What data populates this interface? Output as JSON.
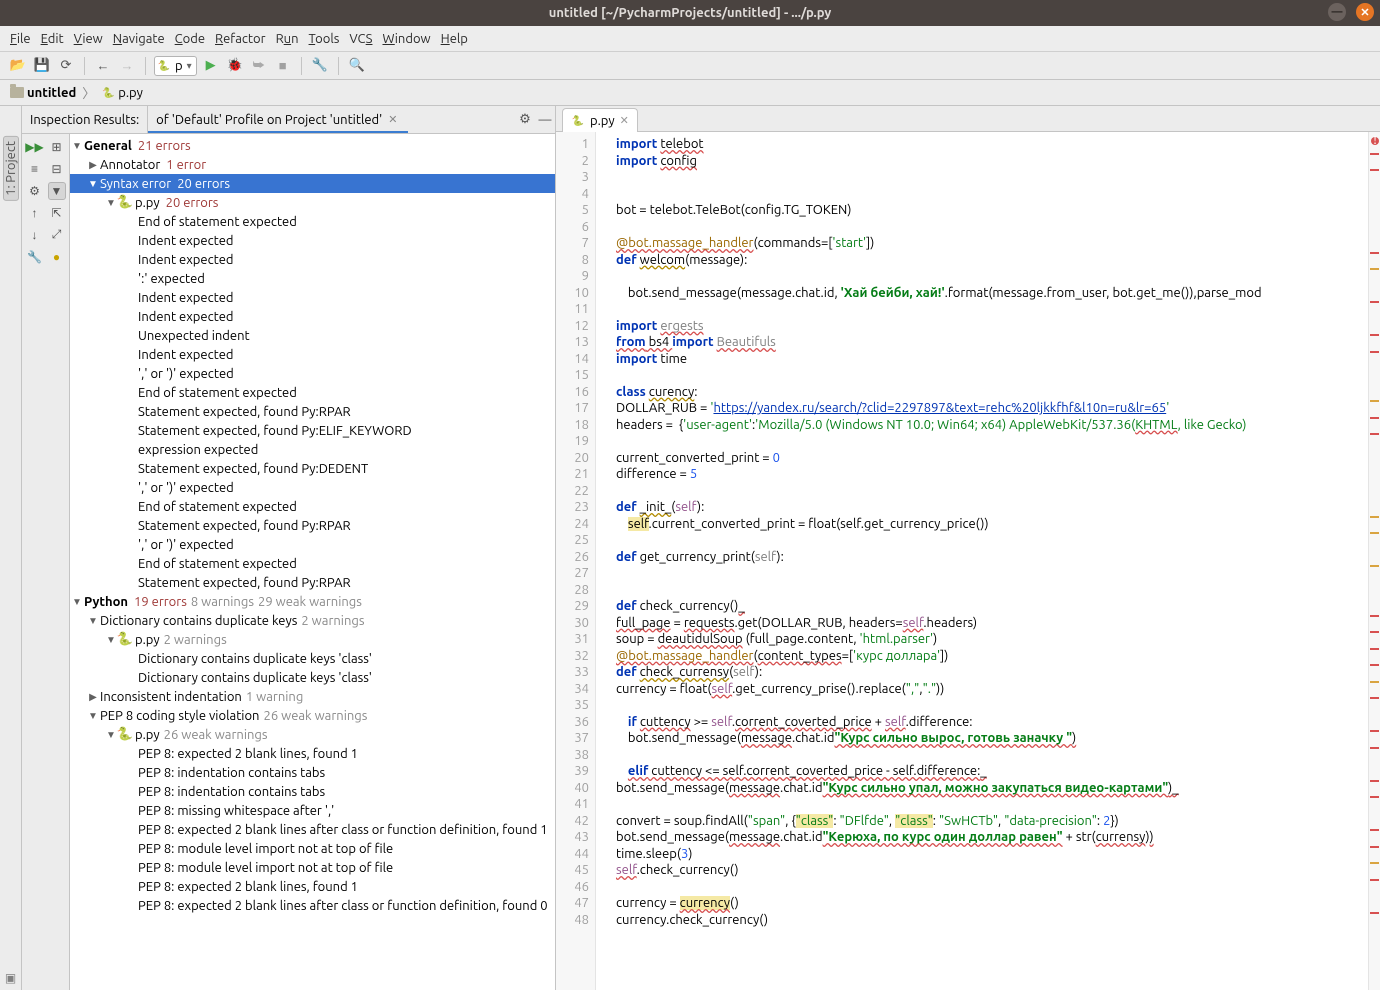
{
  "window": {
    "title": "untitled [~/PycharmProjects/untitled] - .../p.py"
  },
  "menu": [
    "File",
    "Edit",
    "View",
    "Navigate",
    "Code",
    "Refactor",
    "Run",
    "Tools",
    "VCS",
    "Window",
    "Help"
  ],
  "toolbar": {
    "run_config": "p"
  },
  "breadcrumb": {
    "project": "untitled",
    "file": "p.py"
  },
  "left_tool": {
    "project_label": "Project",
    "project_num": "1:"
  },
  "inspection": {
    "title": "Inspection Results:",
    "profile_tab": "of 'Default' Profile on Project 'untitled'",
    "tree": {
      "general": {
        "label": "General",
        "count": "21 errors"
      },
      "annotator": {
        "label": "Annotator",
        "count": "1 error"
      },
      "syntax": {
        "label": "Syntax error",
        "count": "20 errors"
      },
      "file1": {
        "label": "p.py",
        "count": "20 errors"
      },
      "syntax_items": [
        "End of statement expected",
        "Indent expected",
        "Indent expected",
        "':' expected",
        "Indent expected",
        "Indent expected",
        "Unexpected indent",
        "Indent expected",
        "',' or ')' expected",
        "End of statement expected",
        "Statement expected, found Py:RPAR",
        "Statement expected, found Py:ELIF_KEYWORD",
        "expression expected",
        "Statement expected, found Py:DEDENT",
        "',' or ')' expected",
        "End of statement expected",
        "Statement expected, found Py:RPAR",
        "',' or ')' expected",
        "End of statement expected",
        "Statement expected, found Py:RPAR"
      ],
      "python": {
        "label": "Python",
        "count_err": "19 errors",
        "count_warn": "8 warnings",
        "count_weak": "29 weak warnings"
      },
      "dupkeys": {
        "label": "Dictionary contains duplicate keys",
        "count": "2 warnings"
      },
      "file2": {
        "label": "p.py",
        "count": "2 warnings"
      },
      "dup_items": [
        "Dictionary contains duplicate keys 'class'",
        "Dictionary contains duplicate keys 'class'"
      ],
      "indent": {
        "label": "Inconsistent indentation",
        "count": "1 warning"
      },
      "pep8": {
        "label": "PEP 8 coding style violation",
        "count": "26 weak warnings"
      },
      "file3": {
        "label": "p.py",
        "count": "26 weak warnings"
      },
      "pep8_items": [
        "PEP 8: expected 2 blank lines, found 1",
        "PEP 8: indentation contains tabs",
        "PEP 8: indentation contains tabs",
        "PEP 8: missing whitespace after ','",
        "PEP 8: expected 2 blank lines after class or function definition, found 1",
        "PEP 8: module level import not at top of file",
        "PEP 8: module level import not at top of file",
        "PEP 8: expected 2 blank lines, found 1",
        "PEP 8: expected 2 blank lines after class or function definition, found 0"
      ]
    }
  },
  "editor": {
    "tab": "p.py",
    "lines_count": 48,
    "code": {
      "l1": "import telebot",
      "l2": "import config",
      "l5": "bot = telebot.TeleBot(config.TG_TOKEN)",
      "l7a": "@bot.massage_handler",
      "l7b": "(commands=['start'])",
      "l8": "def welcom(message):",
      "l10": "    bot.send_message(message.chat.id, 'Хай бейби, хай!'.format(message.from_user, bot.get_me()),parse_mod",
      "l12": "import ergests",
      "l13": "from bs4 import Beautifuls",
      "l14": "import time",
      "l16": "class curency:",
      "l17a": "DOLLAR_RUB = '",
      "l17b": "https://yandex.ru/search/?clid=2297897&text=rehc%20ljkkfhf&l10n=ru&lr=65",
      "l17c": "'",
      "l18": "headers =  {'user-agent':'Mozilla/5.0 (Windows NT 10.0; Win64; x64) AppleWebKit/537.36(KHTML, like Gecko)",
      "l20": "current_converted_print = 0",
      "l21": "difference = 5",
      "l23": "def _init_(self):",
      "l24": "    self.current_converted_print = float(self.get_currency_price())",
      "l26": "def get_currency_print(self):",
      "l29": "def check_currency()",
      "l30": "full_page = requests.get(DOLLAR_RUB, headers=self.headers)",
      "l31": "soup = deautidulSoup (full_page.content, 'html.parser')",
      "l32a": "@bot.massage_handler",
      "l32b": "(content_types=['курс доллара'])",
      "l33": "def check_currensy(self):",
      "l34": "currency = float(self.get_currency_prise().replace(\",\",\".\"))",
      "l36": "    if cuttency >= self.corrent_coverted_price + self.difference:",
      "l37": "    bot.send_message(message.chat.id\"Курс сильно вырос, готовь заначку \")",
      "l39": "    elif cuttency <= self.corrent_coverted_price - self.difference:",
      "l40": "bot.send_message(message.chat.id\"Курс сильно упал, можно закупаться видео-картами\")",
      "l42": "convert = soup.findAll(\"span\", {\"class\": \"DFlfde\", \"class\": \"SwHCTb\", \"data-precision\": 2})",
      "l43": "bot.send_message(message.chat.id\"Керюха, по курс один доллар равен\" + str(currensy))",
      "l44": "time.sleep(3)",
      "l45": "self.check_currency()",
      "l47": "currency = currency()",
      "l48": "currency.check_currency()"
    }
  }
}
